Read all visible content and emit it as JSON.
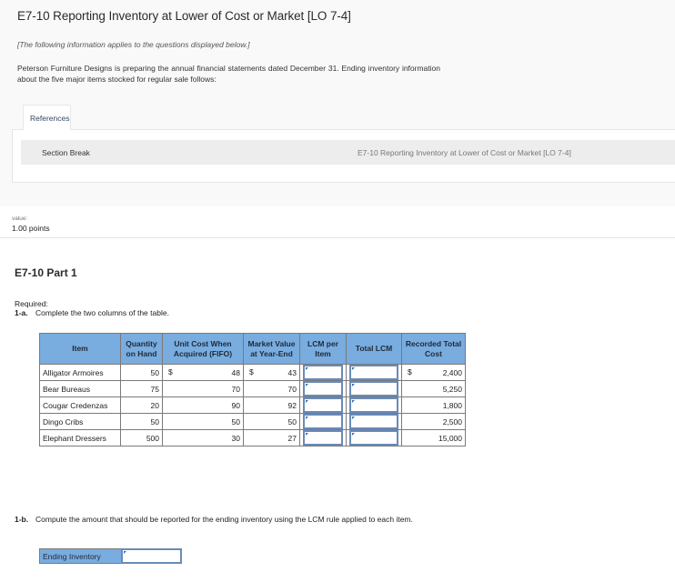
{
  "header": {
    "title": "E7-10 Reporting Inventory at Lower of Cost or Market [LO 7-4]",
    "note": "[The following information applies to the questions displayed below.]",
    "intro": "Peterson Furniture Designs is preparing the annual financial statements dated December 31. Ending inventory information about the five major items stocked for regular sale follows:"
  },
  "references": {
    "tab_label": "References",
    "section_break_label": "Section Break",
    "section_break_ref": "E7-10 Reporting Inventory at Lower of Cost or Market [LO 7-4]"
  },
  "value": {
    "label": "value:",
    "points": "1.00 points"
  },
  "part": {
    "title": "E7-10 Part 1",
    "required_label": "Required:",
    "req_1a_num": "1-a.",
    "req_1a_text": "Complete the two columns of the table.",
    "req_1b_num": "1-b.",
    "req_1b_text": "Compute the amount that should be reported for the ending inventory using the LCM rule applied to each item."
  },
  "table": {
    "headers": {
      "item": "Item",
      "qty": "Quantity on Hand",
      "unit_cost": "Unit Cost When Acquired (FIFO)",
      "market": "Market Value at Year-End",
      "lcm_per_item": "LCM per Item",
      "total_lcm": "Total LCM",
      "recorded": "Recorded Total Cost"
    },
    "currency_symbol": "$",
    "rows": [
      {
        "item": "Alligator Armoires",
        "qty": "50",
        "unit_cost": "48",
        "market": "43",
        "lcm_per_item": "",
        "total_lcm": "",
        "recorded": "2,400"
      },
      {
        "item": "Bear Bureaus",
        "qty": "75",
        "unit_cost": "70",
        "market": "70",
        "lcm_per_item": "",
        "total_lcm": "",
        "recorded": "5,250"
      },
      {
        "item": "Cougar Credenzas",
        "qty": "20",
        "unit_cost": "90",
        "market": "92",
        "lcm_per_item": "",
        "total_lcm": "",
        "recorded": "1,800"
      },
      {
        "item": "Dingo Cribs",
        "qty": "50",
        "unit_cost": "50",
        "market": "50",
        "lcm_per_item": "",
        "total_lcm": "",
        "recorded": "2,500"
      },
      {
        "item": "Elephant Dressers",
        "qty": "500",
        "unit_cost": "30",
        "market": "27",
        "lcm_per_item": "",
        "total_lcm": "",
        "recorded": "15,000"
      }
    ]
  },
  "ending_inventory": {
    "label": "Ending Inventory",
    "value": ""
  },
  "colors": {
    "header_fill": "#79acdf",
    "input_border": "#6a8ab8",
    "input_marker": "#3a6cc0"
  }
}
